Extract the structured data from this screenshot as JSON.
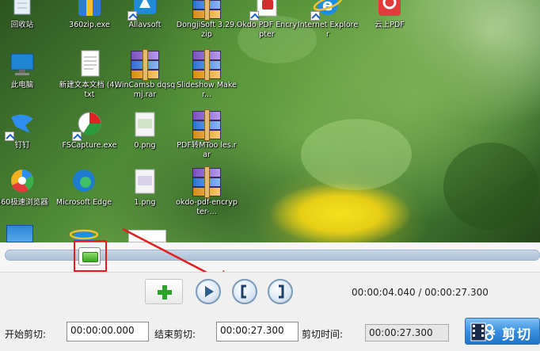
{
  "preview": {
    "desktop_icons": [
      {
        "label": "回收站",
        "icon": "recycle-bin-icon"
      },
      {
        "label": "360zip.exe",
        "icon": "zip-app-icon"
      },
      {
        "label": "Allavsoft",
        "icon": "allavsoft-icon"
      },
      {
        "label": "DongjiSoft 3.29.zip",
        "icon": "archive-icon"
      },
      {
        "label": "Okdo PDF Encrypter",
        "icon": "pdf-encrypter-icon"
      },
      {
        "label": "Internet Explorer",
        "icon": "internet-explorer-icon"
      },
      {
        "label": "云上PDF",
        "icon": "cloud-pdf-icon"
      },
      {
        "label": "此电脑",
        "icon": "computer-icon"
      },
      {
        "label": "新建文本文档 (4).txt",
        "icon": "text-file-icon"
      },
      {
        "label": "WinCamsb dqsqmj.rar",
        "icon": "archive-icon"
      },
      {
        "label": "Slideshow Maker...",
        "icon": "archive-icon"
      },
      {
        "label": "钉钉",
        "icon": "dingtalk-icon"
      },
      {
        "label": "FSCapture.exe",
        "icon": "fscapture-icon"
      },
      {
        "label": "0.png",
        "icon": "image-file-icon"
      },
      {
        "label": "PDF转MToo les.rar",
        "icon": "archive-icon"
      },
      {
        "label": "360极速浏览器",
        "icon": "browser-360-icon"
      },
      {
        "label": "Microsoft Edge",
        "icon": "edge-icon"
      },
      {
        "label": "1.png",
        "icon": "image-file-icon"
      },
      {
        "label": "okdo-pdf-encrypter-...",
        "icon": "archive-icon"
      }
    ]
  },
  "timeline": {
    "position_fraction": 0.147
  },
  "controls": {
    "add_icon": "plus-icon",
    "play_icon": "play-icon",
    "set_start_icon": "left-bracket-icon",
    "set_end_icon": "right-bracket-icon",
    "time_readout": "00:00:04.040 / 00:00:27.300"
  },
  "bottom": {
    "start_label": "开始剪切:",
    "start_value": "00:00:00.000",
    "end_label": "结束剪切:",
    "end_value": "00:00:27.300",
    "duration_label": "剪切时间:",
    "duration_value": "00:00:27.300",
    "cut_button_label": "剪切",
    "cut_icon": "film-scissors-icon"
  },
  "colors": {
    "annotation": "#e31e1e",
    "accent": "#3a90de",
    "add_green": "#2aa52a"
  }
}
